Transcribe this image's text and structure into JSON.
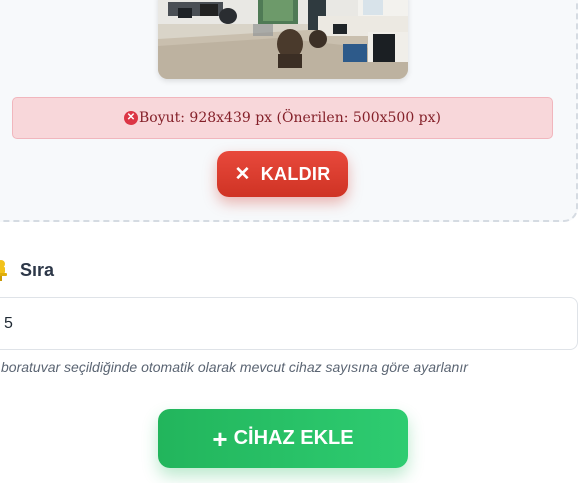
{
  "upload": {
    "preview_alt": "lab-photo-preview",
    "size_message": "Boyut: 928x439 px (Önerilen: 500x500 px)",
    "remove_label": "KALDIR"
  },
  "order_field": {
    "label": "Sıra",
    "value": "5",
    "hint": "boratuvar seçildiğinde otomatik olarak mevcut cihaz sayısına göre ayarlanır"
  },
  "actions": {
    "add_device_label": "CİHAZ EKLE"
  },
  "icons": {
    "error": "x-circle-icon",
    "remove": "close-icon",
    "order": "pin-icon",
    "add": "plus-icon"
  },
  "colors": {
    "danger": "#dc3545",
    "remove_button": "#e04535",
    "success": "#2ecc71",
    "alert_bg": "#f8d7da"
  }
}
